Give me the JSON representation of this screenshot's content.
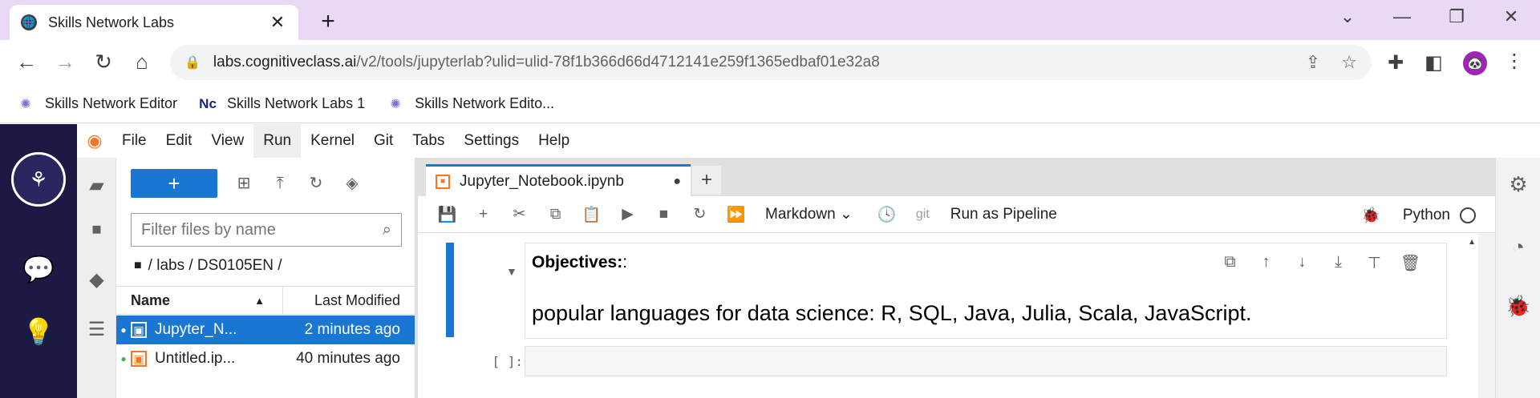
{
  "browser": {
    "tab_title": "Skills Network Labs",
    "url_host": "labs.cognitiveclass.ai",
    "url_path": "/v2/tools/jupyterlab?ulid=ulid-78f1b366d66d4712141e259f1365edbaf01e32a8",
    "bookmarks": [
      {
        "label": "Skills Network Editor"
      },
      {
        "label": "Skills Network Labs 1"
      },
      {
        "label": "Skills Network Edito..."
      }
    ]
  },
  "jupyter": {
    "menus": [
      "File",
      "Edit",
      "View",
      "Run",
      "Kernel",
      "Git",
      "Tabs",
      "Settings",
      "Help"
    ],
    "active_menu": "Run",
    "file_browser": {
      "filter_placeholder": "Filter files by name",
      "breadcrumb": "/ labs / DS0105EN /",
      "col_name": "Name",
      "col_modified": "Last Modified",
      "files": [
        {
          "name": "Jupyter_N...",
          "modified": "2 minutes ago",
          "selected": true
        },
        {
          "name": "Untitled.ip...",
          "modified": "40 minutes ago",
          "selected": false
        }
      ]
    },
    "notebook": {
      "tab_title": "Jupyter_Notebook.ipynb",
      "cell_type": "Markdown",
      "git_label": "git",
      "run_pipeline": "Run as Pipeline",
      "kernel_name": "Python",
      "md_heading": "Objectives:",
      "md_heading_suffix": ":",
      "md_text": "popular languages for data science: R, SQL, Java, Julia, Scala, JavaScript.",
      "code_prompt": "[ ]:"
    }
  },
  "colors": {
    "accent": "#1976d2",
    "sidebar": "#1c1a44",
    "tabstrip": "#e8d9f5",
    "jupyter_orange": "#f37726"
  }
}
